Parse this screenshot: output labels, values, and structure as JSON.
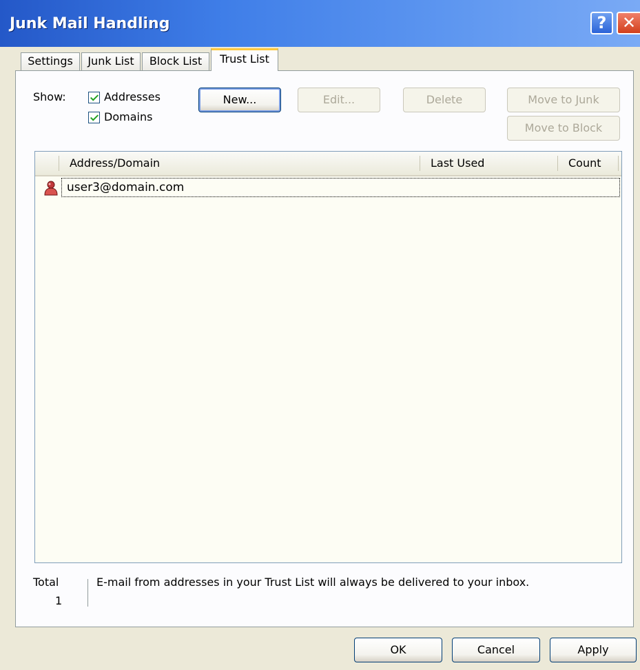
{
  "window": {
    "title": "Junk Mail Handling",
    "help_label": "?",
    "close_label": "✕"
  },
  "tabs": [
    {
      "label": "Settings"
    },
    {
      "label": "Junk List"
    },
    {
      "label": "Block List"
    },
    {
      "label": "Trust List",
      "active": true
    }
  ],
  "show": {
    "label": "Show:",
    "addresses": {
      "label": "Addresses",
      "checked": true
    },
    "domains": {
      "label": "Domains",
      "checked": true
    }
  },
  "buttons": {
    "new": "New...",
    "edit": "Edit...",
    "delete": "Delete",
    "move_to_junk": "Move to Junk",
    "move_to_block": "Move to Block"
  },
  "list": {
    "columns": [
      "Address/Domain",
      "Last Used",
      "Count"
    ],
    "rows": [
      {
        "icon": "person-icon",
        "address": "user3@domain.com",
        "last_used": "",
        "count": ""
      }
    ]
  },
  "footer": {
    "total_label": "Total",
    "total_value": "1",
    "message": "E-mail from addresses in your Trust List will always be delivered to your inbox."
  },
  "dialog_buttons": {
    "ok": "OK",
    "cancel": "Cancel",
    "apply": "Apply"
  },
  "colors": {
    "titlebar": "#2458c8",
    "dialog_bg": "#ece9d8",
    "panel_bg": "#fcfcfe",
    "active_tab_accent": "#ffc83c",
    "checkbox_check": "#21a121"
  }
}
